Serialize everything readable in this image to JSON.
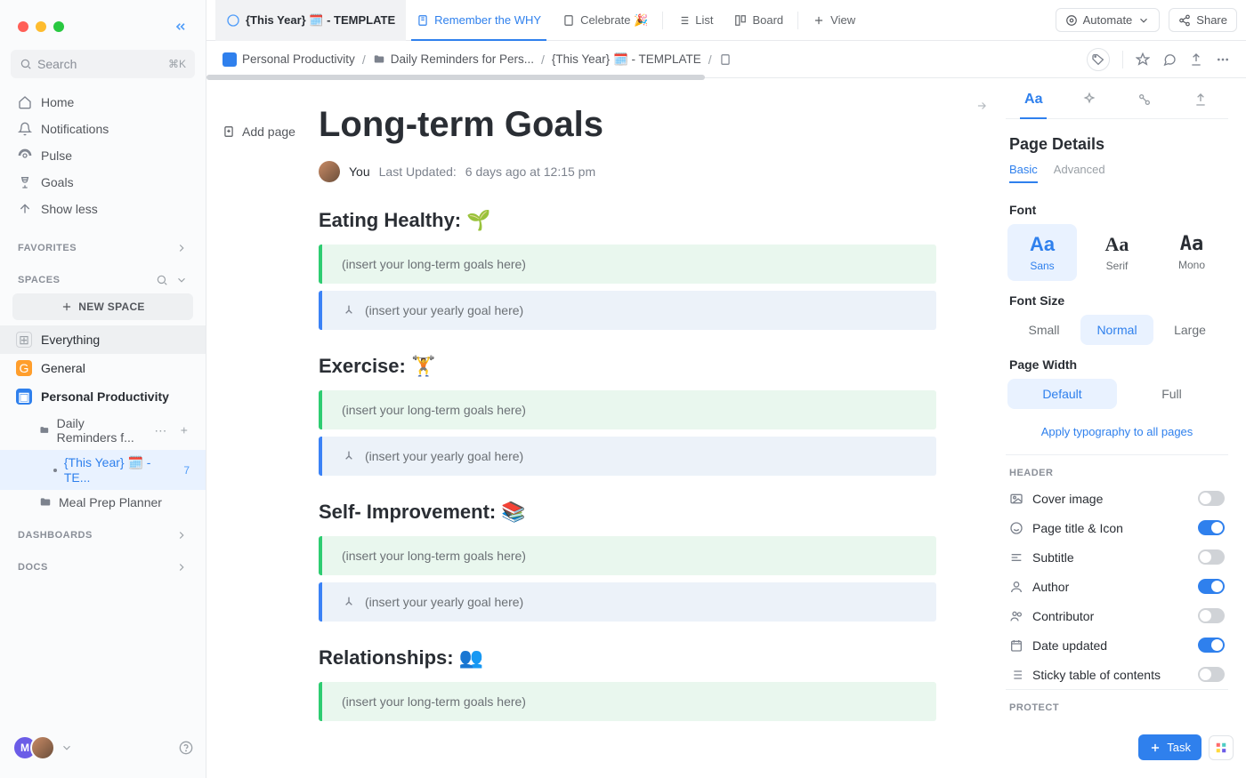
{
  "traffic_colors": [
    "#ff5f57",
    "#febc2e",
    "#28c840"
  ],
  "search_placeholder": "Search",
  "search_shortcut": "⌘K",
  "nav": {
    "home": "Home",
    "notifications": "Notifications",
    "pulse": "Pulse",
    "goals": "Goals",
    "showless": "Show less"
  },
  "sections": {
    "favorites": "FAVORITES",
    "spaces": "SPACES",
    "dashboards": "DASHBOARDS",
    "docs": "DOCS"
  },
  "new_space": "NEW SPACE",
  "spaces": {
    "everything": "Everything",
    "general": "General",
    "personal": "Personal Productivity",
    "daily": "Daily Reminders f...",
    "thisyear": "{This Year} 🗓️ - TE...",
    "thisyear_count": "7",
    "mealprep": "Meal Prep Planner"
  },
  "tabs": {
    "main": "{This Year} 🗓️ - TEMPLATE",
    "remember": "Remember the WHY",
    "celebrate": "Celebrate 🎉",
    "list": "List",
    "board": "Board",
    "view": "View",
    "automate": "Automate",
    "share": "Share"
  },
  "breadcrumb": {
    "b1": "Personal Productivity",
    "b2": "Daily Reminders for Pers...",
    "b3": "{This Year} 🗓️ - TEMPLATE"
  },
  "add_page": "Add page",
  "title": "Long-term Goals",
  "author": "You",
  "updated_label": "Last Updated:",
  "updated_value": "6 days ago at 12:15 pm",
  "sections_body": {
    "s1": {
      "h": "Eating Healthy: 🌱",
      "long": "(insert your long-term goals here)",
      "year": "(insert your yearly goal here)"
    },
    "s2": {
      "h": "Exercise: 🏋️",
      "long": "(insert your long-term goals here)",
      "year": "(insert your yearly goal here)"
    },
    "s3": {
      "h": "Self- Improvement: 📚",
      "long": "(insert your long-term goals here)",
      "year": "(insert your yearly goal here)"
    },
    "s4": {
      "h": "Relationships: 👥",
      "long": "(insert your long-term goals here)"
    }
  },
  "rpanel": {
    "title": "Page Details",
    "basic": "Basic",
    "advanced": "Advanced",
    "font_label": "Font",
    "sans": "Sans",
    "serif": "Serif",
    "mono": "Mono",
    "fontsize_label": "Font Size",
    "small": "Small",
    "normal": "Normal",
    "large": "Large",
    "width_label": "Page Width",
    "default": "Default",
    "full": "Full",
    "apply": "Apply typography to all pages",
    "header_sec": "HEADER",
    "cover": "Cover image",
    "ptitle": "Page title & Icon",
    "subtitle": "Subtitle",
    "author": "Author",
    "contrib": "Contributor",
    "dateupd": "Date updated",
    "sticky": "Sticky table of contents",
    "protect_sec": "PROTECT"
  },
  "task_btn": "Task"
}
